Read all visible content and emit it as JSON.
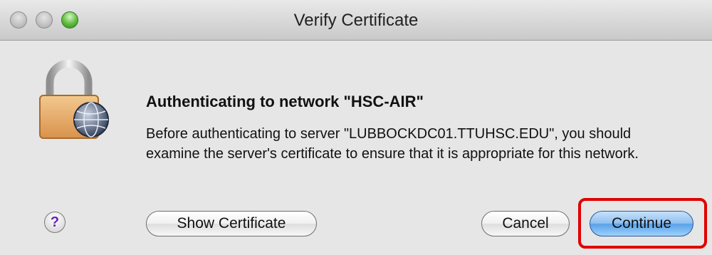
{
  "window": {
    "title": "Verify Certificate"
  },
  "dialog": {
    "heading": "Authenticating to network \"HSC-AIR\"",
    "message": "Before authenticating to server \"LUBBOCKDC01.TTUHSC.EDU\", you should examine the server's certificate to ensure that it is appropriate for this network.",
    "icon": "lock-with-network-globe-icon"
  },
  "buttons": {
    "help_label": "?",
    "show_certificate_label": "Show Certificate",
    "cancel_label": "Cancel",
    "continue_label": "Continue"
  },
  "colors": {
    "highlight_border": "#e00000",
    "default_button": "#5aa2e8",
    "help_glyph": "#6a22b8"
  }
}
